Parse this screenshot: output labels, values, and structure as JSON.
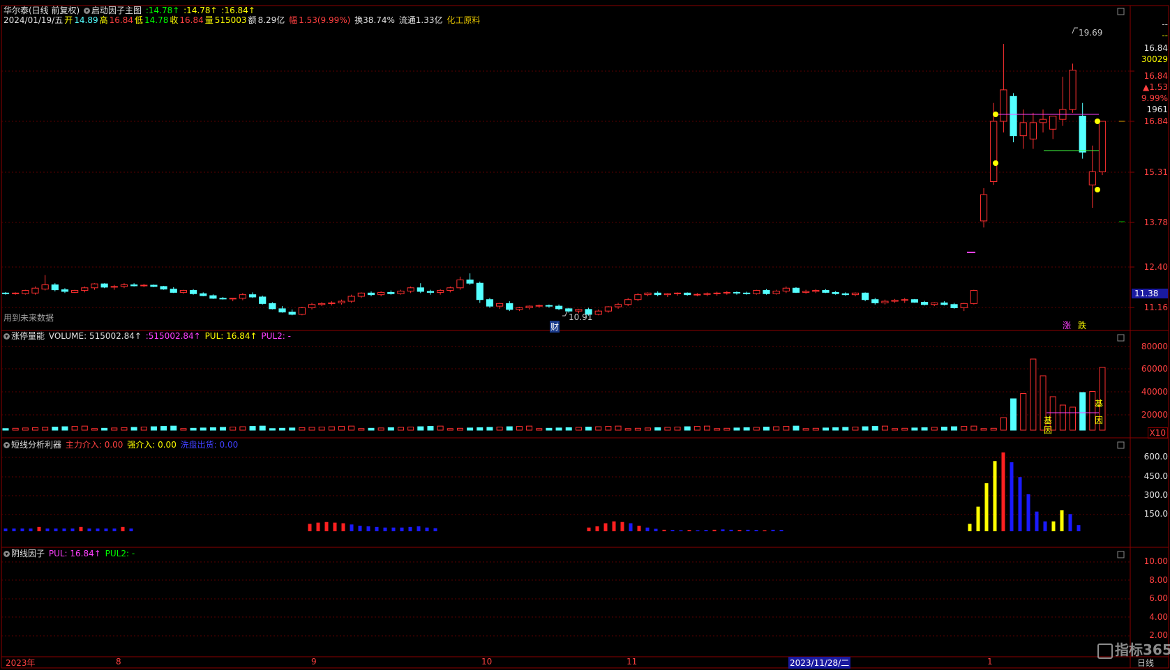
{
  "stock": {
    "name": "华尔泰(日线 前复权)",
    "indicator": "启动因子主图",
    "v1": ":14.78↑",
    "v2": ":14.78↑",
    "v3": ":16.84↑"
  },
  "info": {
    "date": "2024/01/19/五",
    "open_l": "开",
    "open": "14.89",
    "high_l": "高",
    "high": "16.84",
    "low_l": "低",
    "low": "14.78",
    "close_l": "收",
    "close": "16.84",
    "vol_l": "量",
    "vol": "515003",
    "amt_l": "额",
    "amt": "8.29亿",
    "chg_l": "幅",
    "chg": "1.53(9.99%)",
    "turn": "换38.74%",
    "float": "流通1.33亿",
    "sector": "化工原料"
  },
  "main_notes": {
    "future": "用到未来数据",
    "high_mark": "19.69",
    "low_mark": "10.91",
    "fin_badge": "财",
    "up_badge": "涨",
    "down_badge": "跌"
  },
  "price_axis": {
    "top1": "--",
    "top2": "--",
    "p_close": "16.84",
    "vol": "30029",
    "p_red": "16.84",
    "chg": "▲1.53",
    "pct": "9.99%",
    "num": "1961",
    "ticks": [
      "16.84",
      "15.31",
      "13.78",
      "12.40",
      "11.16"
    ],
    "cursor": "11.38"
  },
  "vol_panel": {
    "title": "涨停量能",
    "label1": "VOLUME: 515002.84↑",
    "label2": ":515002.84↑",
    "label3": "PUL: 16.84↑",
    "label4": "PUL2: -",
    "ticks": [
      "80000",
      "60000",
      "40000",
      "20000"
    ],
    "unit": "X10",
    "gene1": "基因",
    "gene2": "基因"
  },
  "short_panel": {
    "title": "短线分析利器",
    "label1": "主力介入: 0.00",
    "label2": "强介入: 0.00",
    "label3": "洗盘出货: 0.00",
    "ticks": [
      "600.0",
      "450.0",
      "300.0",
      "150.0"
    ]
  },
  "yin_panel": {
    "title": "阴线因子",
    "label1": "PUL: 16.84↑",
    "label2": "PUL2: -",
    "ticks": [
      "10.00",
      "8.00",
      "6.00",
      "4.00",
      "2.00"
    ]
  },
  "x_axis": {
    "labels": [
      "2023年",
      "8",
      "9",
      "10",
      "11",
      "2023/11/28/二",
      "1"
    ],
    "period": "日线"
  },
  "watermark": "指标365",
  "colors": {
    "up": "#ff3030",
    "down": "#54ffff",
    "magenta": "#ff00ff",
    "yellow": "#ffff00",
    "blue": "#1a1aff",
    "grid": "#8b0000"
  },
  "chart_data": {
    "type": "candlestick",
    "note": "daily K-line, OHLC values estimated from axis",
    "candles": [
      [
        11.6,
        11.63,
        11.55,
        11.58
      ],
      [
        11.58,
        11.62,
        11.55,
        11.6
      ],
      [
        11.58,
        11.7,
        11.55,
        11.68
      ],
      [
        11.6,
        11.8,
        11.55,
        11.75
      ],
      [
        11.72,
        12.15,
        11.68,
        11.85
      ],
      [
        11.85,
        11.9,
        11.65,
        11.7
      ],
      [
        11.7,
        11.75,
        11.6,
        11.65
      ],
      [
        11.62,
        11.7,
        11.6,
        11.68
      ],
      [
        11.68,
        11.8,
        11.62,
        11.76
      ],
      [
        11.76,
        11.9,
        11.7,
        11.88
      ],
      [
        11.88,
        11.9,
        11.75,
        11.78
      ],
      [
        11.78,
        11.85,
        11.7,
        11.8
      ],
      [
        11.8,
        11.9,
        11.75,
        11.85
      ],
      [
        11.85,
        11.9,
        11.8,
        11.82
      ],
      [
        11.82,
        11.88,
        11.78,
        11.84
      ],
      [
        11.84,
        11.86,
        11.78,
        11.8
      ],
      [
        11.8,
        11.82,
        11.7,
        11.72
      ],
      [
        11.72,
        11.78,
        11.6,
        11.62
      ],
      [
        11.62,
        11.7,
        11.58,
        11.68
      ],
      [
        11.68,
        11.72,
        11.55,
        11.58
      ],
      [
        11.58,
        11.62,
        11.5,
        11.52
      ],
      [
        11.52,
        11.56,
        11.42,
        11.44
      ],
      [
        11.44,
        11.48,
        11.4,
        11.42
      ],
      [
        11.42,
        11.45,
        11.35,
        11.44
      ],
      [
        11.44,
        11.6,
        11.38,
        11.55
      ],
      [
        11.55,
        11.62,
        11.45,
        11.48
      ],
      [
        11.48,
        11.52,
        11.25,
        11.28
      ],
      [
        11.28,
        11.32,
        11.1,
        11.12
      ],
      [
        11.12,
        11.2,
        11.0,
        11.02
      ],
      [
        11.02,
        11.1,
        10.92,
        10.95
      ],
      [
        10.95,
        11.18,
        10.92,
        11.15
      ],
      [
        11.15,
        11.3,
        11.1,
        11.25
      ],
      [
        11.25,
        11.32,
        11.2,
        11.28
      ],
      [
        11.28,
        11.35,
        11.22,
        11.3
      ],
      [
        11.3,
        11.4,
        11.25,
        11.35
      ],
      [
        11.35,
        11.55,
        11.3,
        11.5
      ],
      [
        11.5,
        11.62,
        11.45,
        11.6
      ],
      [
        11.6,
        11.65,
        11.5,
        11.55
      ],
      [
        11.55,
        11.65,
        11.5,
        11.62
      ],
      [
        11.62,
        11.68,
        11.55,
        11.58
      ],
      [
        11.58,
        11.7,
        11.55,
        11.66
      ],
      [
        11.66,
        11.8,
        11.6,
        11.76
      ],
      [
        11.76,
        11.9,
        11.6,
        11.65
      ],
      [
        11.65,
        11.7,
        11.55,
        11.62
      ],
      [
        11.62,
        11.72,
        11.55,
        11.68
      ],
      [
        11.68,
        11.8,
        11.62,
        11.76
      ],
      [
        11.76,
        12.1,
        11.7,
        12.0
      ],
      [
        12.0,
        12.2,
        11.85,
        11.9
      ],
      [
        11.9,
        11.95,
        11.3,
        11.4
      ],
      [
        11.4,
        11.45,
        11.15,
        11.2
      ],
      [
        11.2,
        11.3,
        11.12,
        11.28
      ],
      [
        11.28,
        11.35,
        11.05,
        11.1
      ],
      [
        11.1,
        11.18,
        11.05,
        11.15
      ],
      [
        11.15,
        11.22,
        11.1,
        11.2
      ],
      [
        11.2,
        11.25,
        11.15,
        11.22
      ],
      [
        11.22,
        11.25,
        11.15,
        11.2
      ],
      [
        11.2,
        11.25,
        11.08,
        11.12
      ],
      [
        11.12,
        11.15,
        11.0,
        11.05
      ],
      [
        11.05,
        11.12,
        10.98,
        11.1
      ],
      [
        11.1,
        11.15,
        10.91,
        10.95
      ],
      [
        10.95,
        11.1,
        10.92,
        11.05
      ],
      [
        11.05,
        11.2,
        11.0,
        11.18
      ],
      [
        11.18,
        11.3,
        11.12,
        11.25
      ],
      [
        11.25,
        11.45,
        11.2,
        11.4
      ],
      [
        11.4,
        11.6,
        11.35,
        11.55
      ],
      [
        11.55,
        11.62,
        11.5,
        11.6
      ],
      [
        11.6,
        11.65,
        11.5,
        11.55
      ],
      [
        11.55,
        11.6,
        11.48,
        11.58
      ],
      [
        11.58,
        11.62,
        11.52,
        11.6
      ],
      [
        11.6,
        11.62,
        11.52,
        11.55
      ],
      [
        11.55,
        11.6,
        11.5,
        11.56
      ],
      [
        11.56,
        11.62,
        11.5,
        11.58
      ],
      [
        11.58,
        11.64,
        11.52,
        11.6
      ],
      [
        11.6,
        11.66,
        11.55,
        11.62
      ],
      [
        11.62,
        11.65,
        11.55,
        11.6
      ],
      [
        11.6,
        11.64,
        11.55,
        11.58
      ],
      [
        11.58,
        11.7,
        11.55,
        11.68
      ],
      [
        11.68,
        11.72,
        11.55,
        11.58
      ],
      [
        11.58,
        11.7,
        11.55,
        11.66
      ],
      [
        11.66,
        11.8,
        11.6,
        11.75
      ],
      [
        11.75,
        11.78,
        11.6,
        11.62
      ],
      [
        11.62,
        11.7,
        11.58,
        11.65
      ],
      [
        11.65,
        11.72,
        11.6,
        11.68
      ],
      [
        11.68,
        11.72,
        11.6,
        11.62
      ],
      [
        11.62,
        11.66,
        11.55,
        11.58
      ],
      [
        11.58,
        11.62,
        11.52,
        11.55
      ],
      [
        11.55,
        11.62,
        11.5,
        11.6
      ],
      [
        11.6,
        11.62,
        11.35,
        11.4
      ],
      [
        11.4,
        11.45,
        11.25,
        11.3
      ],
      [
        11.3,
        11.4,
        11.25,
        11.35
      ],
      [
        11.35,
        11.42,
        11.3,
        11.38
      ],
      [
        11.38,
        11.45,
        11.3,
        11.4
      ],
      [
        11.4,
        11.42,
        11.3,
        11.32
      ],
      [
        11.32,
        11.36,
        11.22,
        11.25
      ],
      [
        11.25,
        11.32,
        11.2,
        11.3
      ],
      [
        11.3,
        11.35,
        11.22,
        11.25
      ],
      [
        11.25,
        11.3,
        11.12,
        11.15
      ],
      [
        11.15,
        11.3,
        11.05,
        11.28
      ],
      [
        11.28,
        11.7,
        11.25,
        11.68
      ],
      [
        13.8,
        14.8,
        13.6,
        14.6
      ],
      [
        15.0,
        17.4,
        14.9,
        16.84
      ],
      [
        16.84,
        19.2,
        16.5,
        17.8
      ],
      [
        17.6,
        17.7,
        16.2,
        16.4
      ],
      [
        16.4,
        17.2,
        16.0,
        16.8
      ],
      [
        16.3,
        17.1,
        16.0,
        16.8
      ],
      [
        16.8,
        17.2,
        16.5,
        16.9
      ],
      [
        16.6,
        17.0,
        16.3,
        17.0
      ],
      [
        16.9,
        18.2,
        16.7,
        17.2
      ],
      [
        17.2,
        18.6,
        17.1,
        18.4
      ],
      [
        17.0,
        17.4,
        15.7,
        15.9
      ],
      [
        14.9,
        16.1,
        14.2,
        15.3
      ],
      [
        15.3,
        16.84,
        15.2,
        16.84
      ]
    ]
  }
}
